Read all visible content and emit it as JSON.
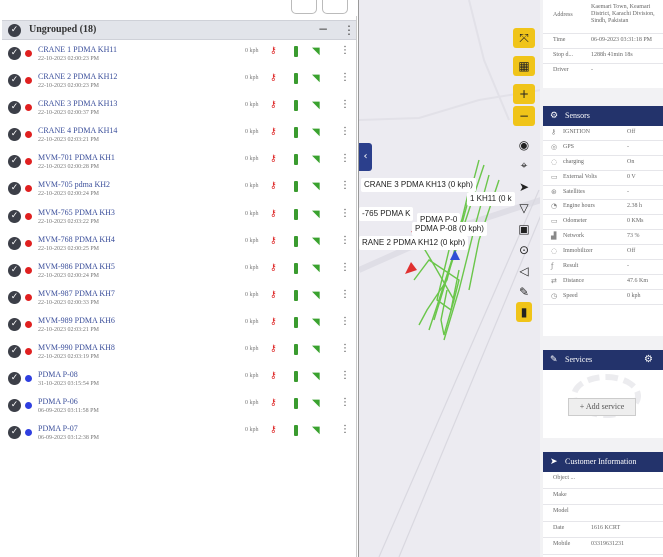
{
  "group": {
    "title": "Ungrouped (18)",
    "toggle_icon": "minus-icon",
    "menu_icon": "kebab-icon"
  },
  "devices": [
    {
      "name": "CRANE 1 PDMA KH11",
      "time": "22-10-2023 02:00:23 PM",
      "speed": "0 kph",
      "status": "red"
    },
    {
      "name": "CRANE 2 PDMA KH12",
      "time": "22-10-2023 02:00:23 PM",
      "speed": "0 kph",
      "status": "red"
    },
    {
      "name": "CRANE 3 PDMA KH13",
      "time": "22-10-2023 02:00:37 PM",
      "speed": "0 kph",
      "status": "red"
    },
    {
      "name": "CRANE 4 PDMA KH14",
      "time": "22-10-2023 02:03:21 PM",
      "speed": "0 kph",
      "status": "red"
    },
    {
      "name": "MVM-701 PDMA KH1",
      "time": "22-10-2023 02:00:28 PM",
      "speed": "0 kph",
      "status": "red"
    },
    {
      "name": "MVM-705 pdma KH2",
      "time": "22-10-2023 02:00:24 PM",
      "speed": "0 kph",
      "status": "red"
    },
    {
      "name": "MVM-765 PDMA KH3",
      "time": "22-10-2023 02:03:22 PM",
      "speed": "0 kph",
      "status": "red"
    },
    {
      "name": "MVM-768 PDMA KH4",
      "time": "22-10-2023 02:00:25 PM",
      "speed": "0 kph",
      "status": "red"
    },
    {
      "name": "MVM-986 PDMA KH5",
      "time": "22-10-2023 02:00:24 PM",
      "speed": "0 kph",
      "status": "red"
    },
    {
      "name": "MVM-987 PDMA KH7",
      "time": "22-10-2023 02:00:33 PM",
      "speed": "0 kph",
      "status": "red"
    },
    {
      "name": "MVM-989 PDMA KH6",
      "time": "22-10-2023 02:03:21 PM",
      "speed": "0 kph",
      "status": "red"
    },
    {
      "name": "MVM-990 PDMA KH8",
      "time": "22-10-2023 02:03:19 PM",
      "speed": "0 kph",
      "status": "red"
    },
    {
      "name": "PDMA P-08",
      "time": "31-10-2023 03:15:54 PM",
      "speed": "0 kph",
      "status": "blue"
    },
    {
      "name": "PDMA P-06",
      "time": "06-09-2023 03:11:58 PM",
      "speed": "0 kph",
      "status": "blue"
    },
    {
      "name": "PDMA P-07",
      "time": "06-09-2023 03:12:38 PM",
      "speed": "0 kph",
      "status": "blue"
    }
  ],
  "row_icons": {
    "check": "check-circle-icon",
    "key": "key-icon",
    "battery": "battery-icon",
    "signal": "wifi-signal-icon",
    "menu": "kebab-icon"
  },
  "map": {
    "labels": {
      "crane3": "CRANE 3 PDMA KH13 (0 kph)",
      "kh11": "1 KH11 (0 k",
      "mvm765": "-765 PDMA K",
      "pdma": "PDMA P-0",
      "p08": "PDMA P-08 (0 kph)",
      "crane2": "RANE 2 PDMA KH12 (0 kph)"
    },
    "controls": [
      "fullscreen-icon",
      "layers-icon",
      "zoom-in-icon",
      "zoom-out-icon",
      "eye-icon",
      "crosshair-icon",
      "navigate-arrow-icon",
      "filter-icon",
      "lock-icon",
      "pin-icon",
      "sound-icon",
      "ruler-icon",
      "tag-icon"
    ]
  },
  "info": {
    "address_label": "Address",
    "address_value": "Kaemari Town, Keamari District, Karachi Division, Sindh, Pakistan",
    "time_label": "Time",
    "time_value": "06-09-2023 03:31:18 PM",
    "stop_label": "Stop d...",
    "stop_value": "1288h 41min 18s",
    "driver_label": "Driver",
    "driver_value": "-"
  },
  "sensors": {
    "title": "Sensors",
    "items": [
      {
        "label": "IGNITION",
        "value": "Off",
        "icon": "key-icon"
      },
      {
        "label": "GPS",
        "value": "-",
        "icon": "gps-icon"
      },
      {
        "label": "charging",
        "value": "On",
        "icon": "plug-icon"
      },
      {
        "label": "External Volts",
        "value": "0 V",
        "icon": "battery-icon"
      },
      {
        "label": "Satellites",
        "value": "-",
        "icon": "satellite-icon"
      },
      {
        "label": "Engine hours",
        "value": "2.38 h",
        "icon": "engine-icon"
      },
      {
        "label": "Odometer",
        "value": "0 KMs",
        "icon": "odometer-icon"
      },
      {
        "label": "Network",
        "value": "73 %",
        "icon": "signal-icon"
      },
      {
        "label": "Immobilizer",
        "value": "Off",
        "icon": "immobilizer-icon"
      },
      {
        "label": "Result",
        "value": "-",
        "icon": "result-icon"
      },
      {
        "label": "Distance",
        "value": "47.6 Km",
        "icon": "distance-icon"
      },
      {
        "label": "Speed",
        "value": "0 kph",
        "icon": "speed-icon"
      }
    ]
  },
  "services": {
    "title": "Services",
    "add_label": "+ Add service"
  },
  "customer": {
    "title": "Customer Information",
    "fields": [
      {
        "label": "Object ...",
        "value": ""
      },
      {
        "label": "Make",
        "value": ""
      },
      {
        "label": "Model",
        "value": ""
      },
      {
        "label": "Date",
        "value": "1616 KCRT"
      },
      {
        "label": "Mobile",
        "value": "03319631231"
      }
    ]
  }
}
